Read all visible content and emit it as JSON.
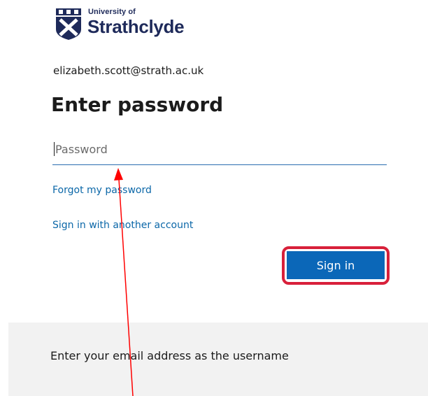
{
  "brand": {
    "line1": "University of",
    "line2": "Strathclyde",
    "color": "#1e2a5a"
  },
  "identity": {
    "email": "elizabeth.scott@strath.ac.uk"
  },
  "page": {
    "title": "Enter password"
  },
  "password_field": {
    "placeholder": "Password",
    "value": ""
  },
  "links": {
    "forgot": "Forgot my password",
    "other_account": "Sign in with another account"
  },
  "sign_in_button": {
    "label": "Sign in",
    "color": "#0b67b8",
    "highlight_color": "#d8203a"
  },
  "footer": {
    "text": "Enter your email address as the username"
  },
  "annotation": {
    "arrow_color": "#ff0000"
  }
}
